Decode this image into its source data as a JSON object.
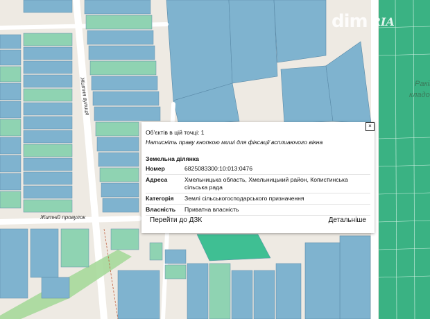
{
  "map": {
    "streets": [
      "Житня вулиця",
      "Житній провулок"
    ],
    "area_label_lines": [
      "Раків",
      "кладо"
    ]
  },
  "logo": {
    "dim": "dim",
    "ria": "RIA"
  },
  "popup": {
    "close_label": "×",
    "objects_line": "Об'єктів в цій точці: 1",
    "hint": "Натисніть праву кнопкою миші для фіксації всплиаючого вікна",
    "section_title": "Земельна ділянка",
    "rows": [
      {
        "key": "Номер",
        "value": "6825083300:10:013:0476"
      },
      {
        "key": "Адреса",
        "value": "Хмельницька область, Хмельницький район, Копистинська сільська рада"
      },
      {
        "key": "Категорія",
        "value": "Землі сільськогосподарського призначення"
      },
      {
        "key": "Власність",
        "value": "Приватна власність"
      }
    ],
    "link_dzk": "Перейти до ДЗК",
    "link_details": "Детальніше"
  },
  "colors": {
    "parcel_blue": "#7fb3cf",
    "parcel_green": "#8fd3b2",
    "parcel_teal": "#5fbfa3",
    "cemetery_green": "#3ab283",
    "road_white": "#ffffff",
    "background": "#f2efe9"
  }
}
